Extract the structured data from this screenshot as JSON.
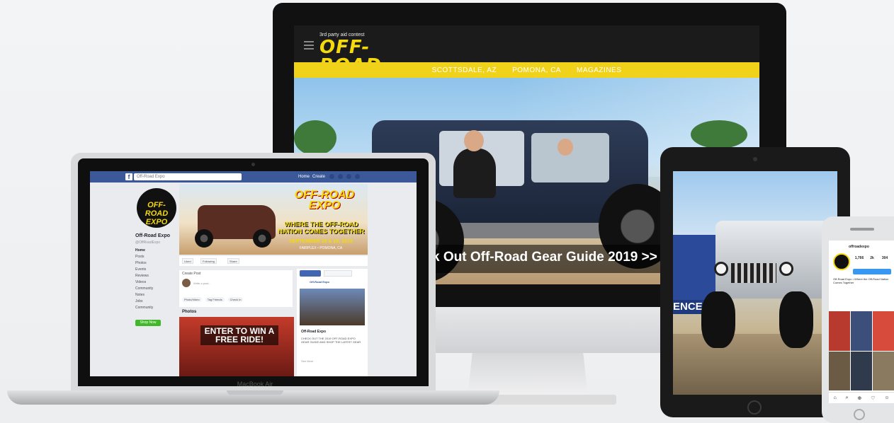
{
  "imac": {
    "site": {
      "logo_top": "3rd party aid contest",
      "logo_main": "OFF-ROAD EXPO",
      "nav": [
        "SCOTTSDALE, AZ",
        "POMONA, CA",
        "MAGAZINES"
      ],
      "hero_text": "k Out Off-Road Gear Guide 2019 >>"
    }
  },
  "laptop": {
    "brand": "MacBook Air",
    "facebook": {
      "search_placeholder": "Off-Road Expo",
      "toplinks": [
        "Home",
        "Create"
      ],
      "avatar_text": "OFF-ROAD EXPO",
      "page_name": "Off-Road Expo",
      "handle": "@OffRoadExpo",
      "nav": [
        "Home",
        "Posts",
        "Photos",
        "Events",
        "Reviews",
        "Videos",
        "Community",
        "Notes",
        "Jobs",
        "Community"
      ],
      "shop_label": "Shop Now",
      "cover_title": "OFF-ROAD EXPO",
      "cover_sub": "WHERE THE OFF-ROAD NATION COMES TOGETHER",
      "cover_date": "SEPTEMBER 28 & 29, 2019",
      "cover_place": "FAIRPLEX • POMONA, CA",
      "actions": [
        "Liked",
        "Following",
        "Share"
      ],
      "post_header": "Create Post",
      "post_placeholder": "Write a post...",
      "post_buttons": [
        "Photo/Video",
        "Tag Friends",
        "Check In"
      ],
      "photos_header": "Photos",
      "photo_text": "ENTER TO WIN A FREE RIDE!",
      "right_name": "Off-Road Expo",
      "right_title": "Off-Road Expo",
      "right_body": "CHECK OUT THE 2019 OFF-ROAD EXPO GEAR GUIDE AND SHOP THE LATEST GEAR",
      "right_more": "See More"
    }
  },
  "tablet": {
    "fence_text": "ENCE"
  },
  "phone": {
    "handle": "offroadexpo",
    "stats": [
      "1,766",
      "2k",
      "304"
    ],
    "bio": "Off-Road Expo • Where the Off-Road Nation Comes Together",
    "tab_icons": [
      "⌂",
      "⌕",
      "⊕",
      "♡",
      "☺"
    ]
  }
}
